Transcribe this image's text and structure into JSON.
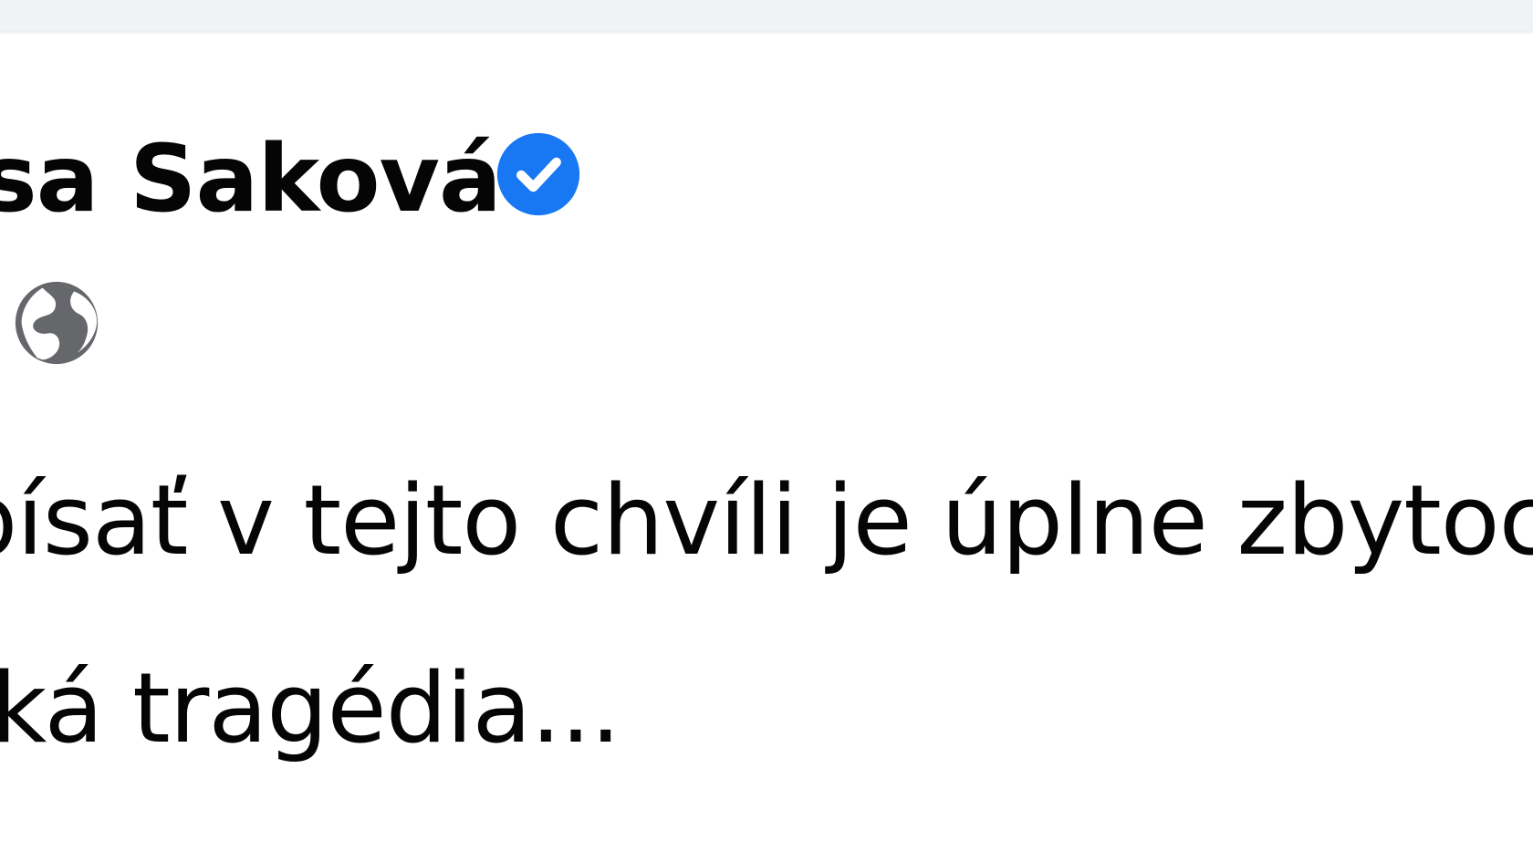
{
  "post": {
    "author_name": "sa Saková",
    "verified": true,
    "privacy": "globe-icon",
    "text_lines": [
      "písať v tejto chvíli je úplne zbytoc",
      "ká tragédia..."
    ]
  },
  "colors": {
    "top_bar": "#f0f2f5",
    "verified_badge": "#1877f2",
    "text": "#050505",
    "secondary_icon": "#65676b"
  }
}
